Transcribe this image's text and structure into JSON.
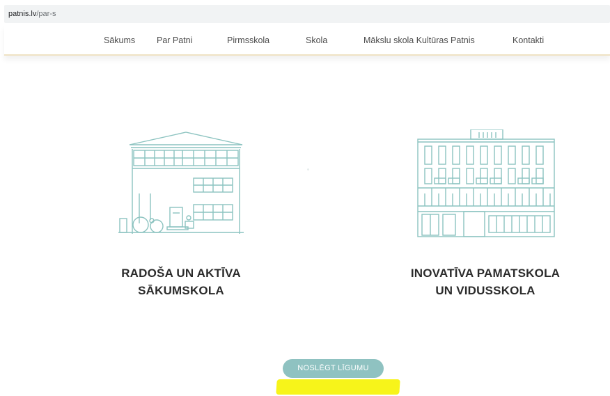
{
  "browser": {
    "domain": "patnis.lv",
    "path": "/par-s"
  },
  "nav": {
    "items": [
      "Sākums",
      "Par Patni",
      "Pirmsskola",
      "Skola",
      "Mākslu skola Kultūras Patnis",
      "Kontakti"
    ]
  },
  "cards": [
    {
      "title_line1": "RADOŠA UN AKTĪVA",
      "title_line2": "SĀKUMSKOLA"
    },
    {
      "title_line1": "INOVATĪVA PAMATSKOLA",
      "title_line2": "UN VIDUSSKOLA"
    }
  ],
  "cta": {
    "label": "NOSLĒGT LĪGUMU"
  },
  "colors": {
    "teal": "#8fc2c1",
    "line_art": "#8cc3c0",
    "highlight": "#f7f41a",
    "nav_border": "#efe2c4"
  }
}
